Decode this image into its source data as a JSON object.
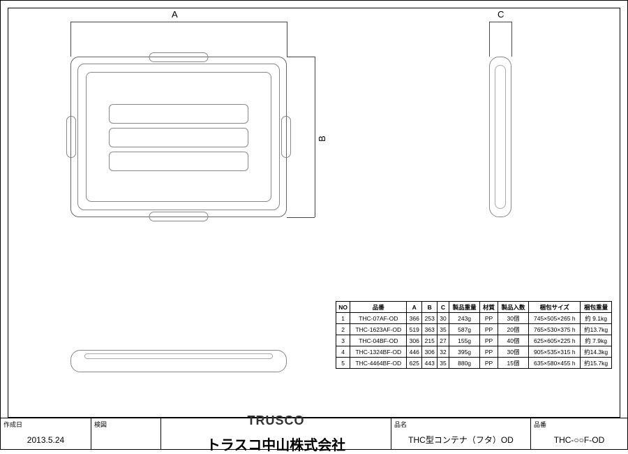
{
  "dims": {
    "A": "A",
    "B": "B",
    "C": "C"
  },
  "table": {
    "headers": [
      "NO",
      "品番",
      "A",
      "B",
      "C",
      "製品重量",
      "材質",
      "製品入数",
      "梱包サイズ",
      "梱包重量"
    ],
    "rows": [
      [
        "1",
        "THC-07AF-OD",
        "366",
        "253",
        "30",
        "243g",
        "PP",
        "30個",
        "745×505×265 h",
        "約 9.1kg"
      ],
      [
        "2",
        "THC-1623AF-OD",
        "519",
        "363",
        "35",
        "587g",
        "PP",
        "20個",
        "765×530×375 h",
        "約13.7kg"
      ],
      [
        "3",
        "THC-04BF-OD",
        "306",
        "215",
        "27",
        "155g",
        "PP",
        "40個",
        "625×605×225 h",
        "約 7.9kg"
      ],
      [
        "4",
        "THC-1324BF-OD",
        "446",
        "306",
        "32",
        "395g",
        "PP",
        "30個",
        "905×535×315 h",
        "約14.3kg"
      ],
      [
        "5",
        "THC-4464BF-OD",
        "625",
        "443",
        "35",
        "880g",
        "PP",
        "15個",
        "635×580×455 h",
        "約15.7kg"
      ]
    ]
  },
  "titleblock": {
    "date_label": "作成日",
    "date_value": "2013.5.24",
    "inspect_label": "検図",
    "logo_trusco": "TRUSCO",
    "logo_jp": "トラスコ中山株式会社",
    "name_label": "品名",
    "name_value": "THC型コンテナ（フタ）OD",
    "number_label": "品番",
    "number_value": "THC-○○F-OD"
  }
}
